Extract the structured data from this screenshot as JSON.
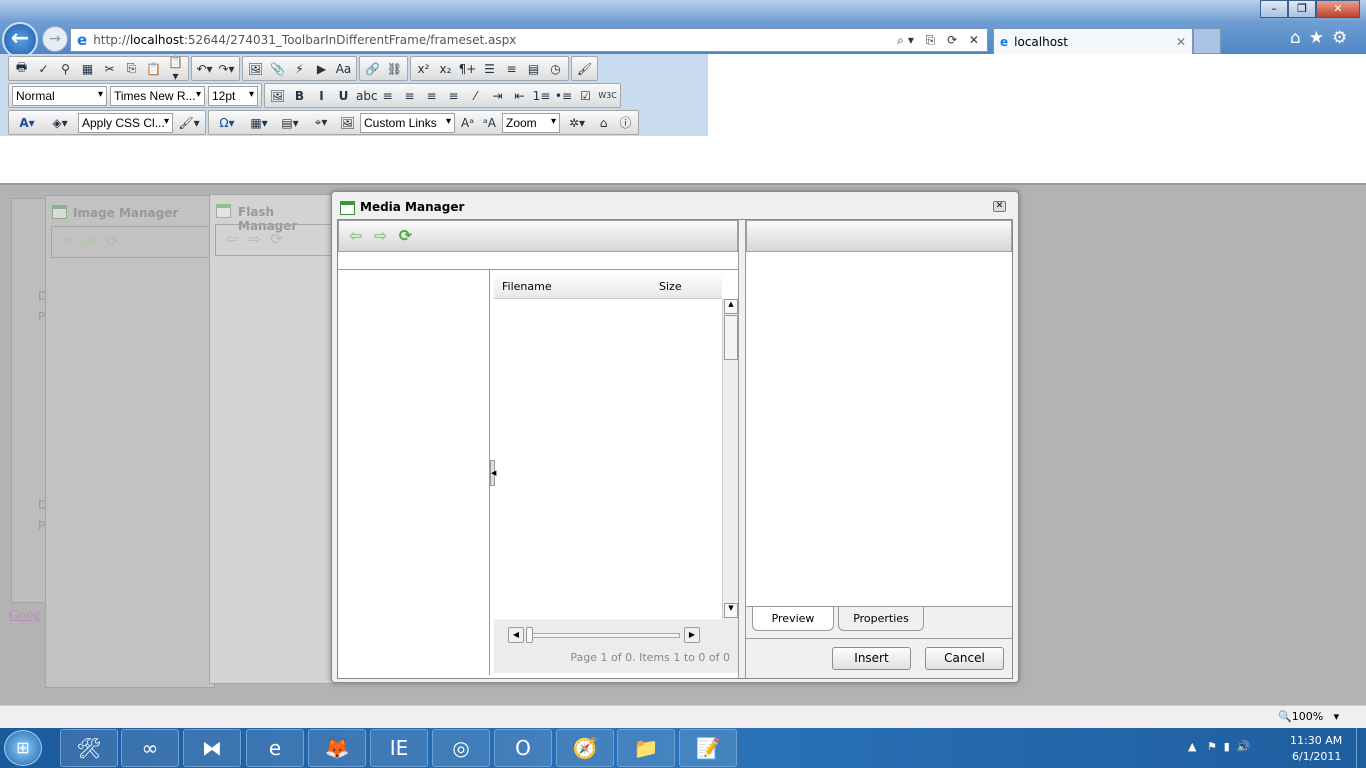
{
  "browser": {
    "address": {
      "prefix": "http://",
      "host": "localhost",
      "rest": ":52644/274031_ToolbarInDifferentFrame/frameset.aspx"
    },
    "tab_label": "localhost",
    "window_buttons": [
      "–",
      "❐",
      "✕"
    ],
    "zoom_level": "100%"
  },
  "editor_toolbar": {
    "row1": [
      [
        "🖶",
        "✓",
        "⚲",
        "▦",
        "✂",
        "⎘",
        "📋",
        "📋▾"
      ],
      [
        "↶▾",
        "↷▾"
      ],
      [
        "🖼",
        "📎",
        "⚡",
        "▶",
        "Aa"
      ],
      [
        "🔗",
        "⛓"
      ],
      [
        "x²",
        "x₂",
        "¶+",
        "☰",
        "≡",
        "▤",
        "◷"
      ],
      [
        "🖌"
      ]
    ],
    "paragraph_style": "Normal",
    "font_name": "Times New R...",
    "font_size": "12pt",
    "row2": [
      "B",
      "I",
      "U",
      "abc",
      "≡",
      "≡",
      "≡",
      "≡",
      "⁄",
      "⇥",
      "⇤",
      "1≡",
      "•≡",
      "☑",
      "W3C"
    ],
    "css_class": "Apply CSS Cl...",
    "custom_links": "Custom Links",
    "zoom": "Zoom",
    "row3a": [
      "A▾",
      "◈▾"
    ],
    "row3b": [
      "🖌▾",
      "Ω▾",
      "▦▾",
      "▤▾",
      "⌖▾",
      "🖼"
    ],
    "row3c": [
      "Aᵃ",
      "ᵃA"
    ],
    "row3d": [
      "✲▾",
      "⌂",
      "ⓘ"
    ]
  },
  "background_dialogs": [
    {
      "title": "Image Manager"
    },
    {
      "title": "Flash Manager"
    }
  ],
  "background_page": {
    "link": "Goog",
    "items": [
      "De",
      "Pr",
      "De",
      "Pr"
    ]
  },
  "media_manager": {
    "title": "Media Manager",
    "columns": [
      "Filename",
      "Size"
    ],
    "pager": "Page 1 of 0. Items 1 to 0 of 0",
    "tabs": [
      "Preview",
      "Properties"
    ],
    "insert_label": "Insert",
    "cancel_label": "Cancel"
  },
  "taskbar": {
    "apps": [
      "🛠",
      "∞",
      "⧓",
      "e",
      "🦊",
      "IE",
      "◎",
      "O",
      "🧭",
      "📁",
      "📝"
    ],
    "time": "11:30 AM",
    "date": "6/1/2011"
  }
}
